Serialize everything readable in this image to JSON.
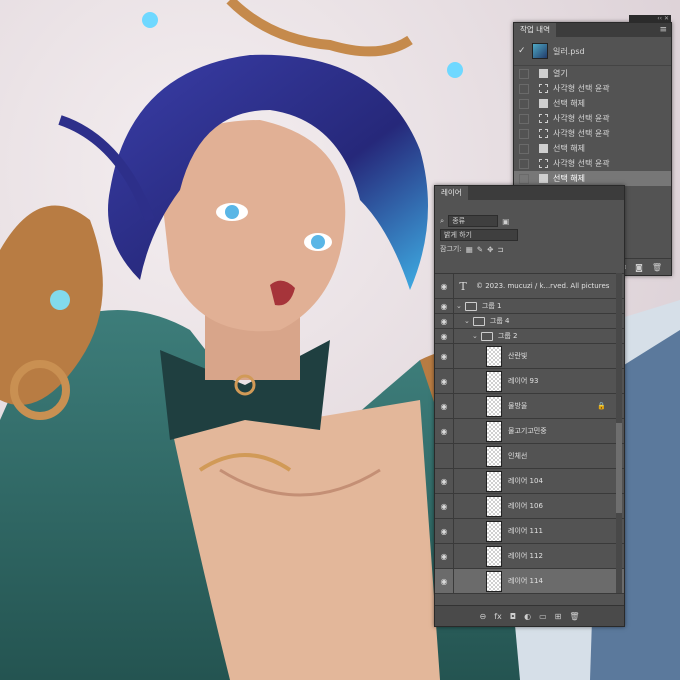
{
  "history_panel": {
    "tab": "작업 내역",
    "source_file": "일러.psd",
    "items": [
      {
        "label": "열기",
        "icon": "document-icon"
      },
      {
        "label": "사각형 선택 윤곽",
        "icon": "marquee-icon"
      },
      {
        "label": "선택 해제",
        "icon": "document-icon"
      },
      {
        "label": "사각형 선택 윤곽",
        "icon": "marquee-icon"
      },
      {
        "label": "사각형 선택 윤곽",
        "icon": "marquee-icon"
      },
      {
        "label": "선택 해제",
        "icon": "document-icon"
      },
      {
        "label": "사각형 선택 윤곽",
        "icon": "marquee-icon"
      },
      {
        "label": "선택 해제",
        "icon": "document-icon",
        "active": true
      }
    ]
  },
  "layers_panel": {
    "tab": "레이어",
    "filter_label": "종류",
    "blend_mode": "밝게 하기",
    "lock_label": "잠그기:",
    "layers": [
      {
        "name": "© 2023. mucuzi / k...rved. All pictures",
        "kind": "text",
        "visible": true,
        "indent": 0
      },
      {
        "name": "그룹 1",
        "kind": "group",
        "visible": true,
        "indent": 0
      },
      {
        "name": "그룹 4",
        "kind": "group",
        "visible": true,
        "indent": 1
      },
      {
        "name": "그룹 2",
        "kind": "group",
        "visible": true,
        "indent": 2
      },
      {
        "name": "산란빛",
        "kind": "layer",
        "visible": true
      },
      {
        "name": "레이어 93",
        "kind": "layer",
        "visible": true
      },
      {
        "name": "물방울",
        "kind": "layer",
        "visible": true,
        "locked": true
      },
      {
        "name": "물고기고민중",
        "kind": "layer",
        "visible": true
      },
      {
        "name": "인체선",
        "kind": "layer",
        "visible": false
      },
      {
        "name": "레이어 104",
        "kind": "layer",
        "visible": true
      },
      {
        "name": "레이어 106",
        "kind": "layer",
        "visible": true
      },
      {
        "name": "레이어 111",
        "kind": "layer",
        "visible": true
      },
      {
        "name": "레이어 112",
        "kind": "layer",
        "visible": true
      },
      {
        "name": "레이어 114",
        "kind": "layer",
        "visible": true,
        "selected": true
      }
    ]
  }
}
